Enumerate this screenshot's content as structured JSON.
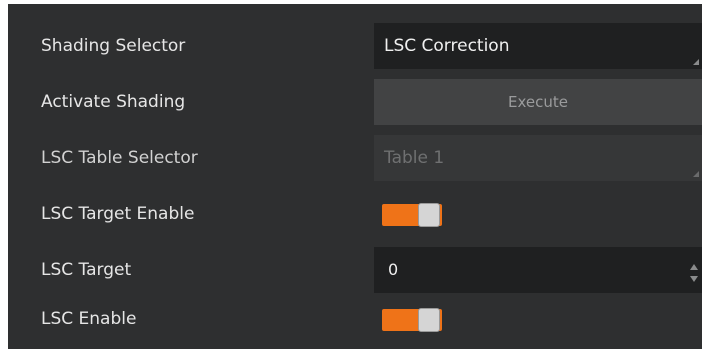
{
  "properties": {
    "shading_selector": {
      "label": "Shading Selector",
      "value": "LSC Correction"
    },
    "activate_shading": {
      "label": "Activate Shading",
      "button": "Execute"
    },
    "lsc_table_selector": {
      "label": "LSC Table Selector",
      "value": "Table 1",
      "disabled": true
    },
    "lsc_target_enable": {
      "label": "LSC Target Enable",
      "enabled": true
    },
    "lsc_target": {
      "label": "LSC Target",
      "value": "0"
    },
    "lsc_enable": {
      "label": "LSC Enable",
      "enabled": true
    }
  },
  "colors": {
    "panel_background": "#2e2f30",
    "field_background": "#1f2021",
    "toggle_on": "#ef7318"
  }
}
